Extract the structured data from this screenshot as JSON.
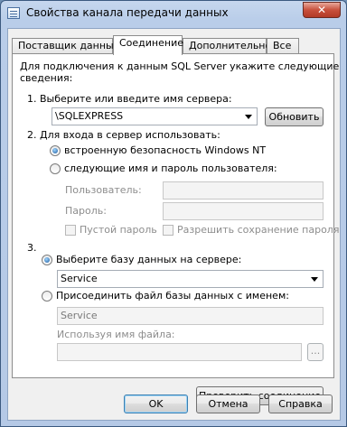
{
  "window": {
    "title": "Свойства канала передачи данных",
    "close_label": "✕"
  },
  "tabs": [
    {
      "label": "Поставщик данных"
    },
    {
      "label": "Соединение"
    },
    {
      "label": "Дополнительно"
    },
    {
      "label": "Все"
    }
  ],
  "connection": {
    "intro_line1": "Для подключения к данным SQL Server укажите следующие",
    "intro_line2": "сведения:",
    "step1_label": "1. Выберите или введите имя сервера:",
    "server_value": "\\SQLEXPRESS",
    "refresh_button": "Обновить",
    "step2_label": "2. Для входа в сервер использовать:",
    "auth_windows": "встроенную безопасность Windows NT",
    "auth_sql": "следующие имя и пароль пользователя:",
    "user_label": "Пользователь:",
    "user_value": "",
    "password_label": "Пароль:",
    "password_value": "",
    "blank_password": "Пустой пароль",
    "save_password": "Разрешить сохранение пароля",
    "step3_label": "3.",
    "select_db": "Выберите базу данных на сервере:",
    "database_value": "Service",
    "attach_db": "Присоединить файл базы данных с именем:",
    "attach_file_value": "Service",
    "logical_name_label": "Используя имя файла:",
    "logical_name_value": "",
    "browse_label": "...",
    "test_button": "Проверить соединение"
  },
  "footer": {
    "ok": "OK",
    "cancel": "Отмена",
    "help": "Справка"
  }
}
